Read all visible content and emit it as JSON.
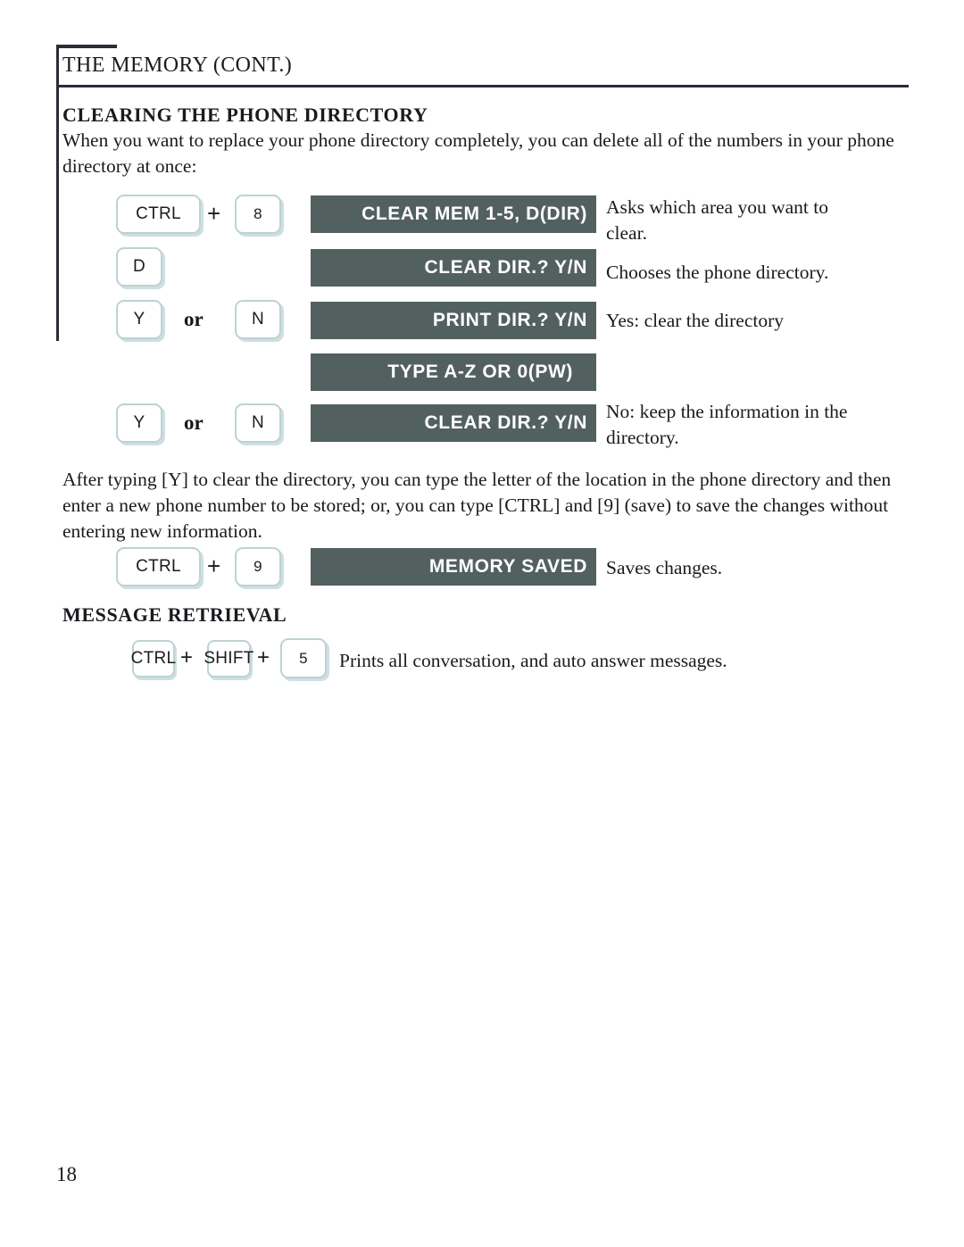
{
  "page": {
    "header_title": "THE MEMORY (CONT.)",
    "page_number": "18"
  },
  "sections": [
    {
      "heading": "CLEARING THE PHONE DIRECTORY",
      "intro_paragraph": "When you want to replace your phone directory completely, you can delete all of the numbers in your phone directory at once:",
      "steps": [
        {
          "keys": [
            "CTRL",
            "8"
          ],
          "separator": "+",
          "display": "CLEAR MEM 1-5, D(DIR)",
          "annotation": "Asks which area you want to clear."
        },
        {
          "keys": [
            "D"
          ],
          "separator": "",
          "display": "CLEAR DIR.? Y/N",
          "annotation": "Chooses the phone directory."
        },
        {
          "keys": [
            "Y",
            "N"
          ],
          "separator": "or",
          "display": "PRINT DIR.? Y/N",
          "annotation": "Yes: clear the directory"
        },
        {
          "keys": [],
          "separator": "",
          "display": "TYPE A-Z OR 0(PW)",
          "annotation": ""
        },
        {
          "keys": [
            "Y",
            "N"
          ],
          "separator": "or",
          "display": "CLEAR DIR.? Y/N",
          "annotation": "No: keep the information in the directory."
        }
      ],
      "after_paragraph": "After typing [Y] to clear the directory, you can type the letter of the location in the phone directory and then enter a new phone number to be stored; or, you can type [CTRL] and [9] (save) to save the changes without entering new information.",
      "save_step": {
        "keys": [
          "CTRL",
          "9"
        ],
        "separator": "+",
        "display": "MEMORY SAVED",
        "annotation": "Saves changes."
      }
    },
    {
      "heading": "MESSAGE RETRIEVAL",
      "shortcut": {
        "key1": "CTRL",
        "plus1": "+",
        "key2": "SHIFT",
        "plus2": "+",
        "key3": "5",
        "annotation": "Prints all conversation, and auto answer messages."
      }
    }
  ],
  "colors": {
    "display_background": "#52615f",
    "display_text": "#ffffff",
    "key_border": "#bcd2d4",
    "key_shadow": "#cfdfe0",
    "rule": "#2b2b38"
  }
}
